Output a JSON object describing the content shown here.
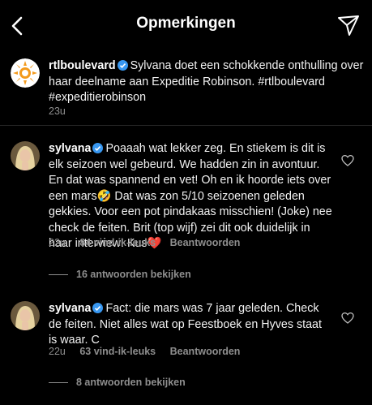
{
  "header": {
    "title": "Opmerkingen"
  },
  "post": {
    "username": "rtlboulevard",
    "text": "Sylvana doet een schokkende onthulling over haar deelname aan Expeditie Robinson. #rtlboulevard #expeditierobinson",
    "time": "23u"
  },
  "comments": [
    {
      "username": "sylvana",
      "text": "Poaaah  wat lekker zeg. En stiekem is dit is elk seizoen wel gebeurd. We hadden zin in avontuur. En dat was spannend en vet! Oh en ik hoorde iets over een mars🤣 Dat was zon 5/10 seizoenen geleden gekkies. Voor een pot pindakaas misschien! (Joke) nee check de feiten. Brit (top wijf) zei dit ook duidelijk in haar interview! Kus❤️",
      "time": "22u",
      "likes": "84 vind-ik-leuks",
      "reply": "Beantwoorden",
      "view_replies": "16 antwoorden bekijken"
    },
    {
      "username": "sylvana",
      "text": "Fact: die mars was 7 jaar geleden. Check de feiten. Niet alles wat op Feestboek en Hyves staat is waar. C",
      "time": "22u",
      "likes": "63 vind-ik-leuks",
      "reply": "Beantwoorden",
      "view_replies": "8 antwoorden bekijken"
    }
  ]
}
